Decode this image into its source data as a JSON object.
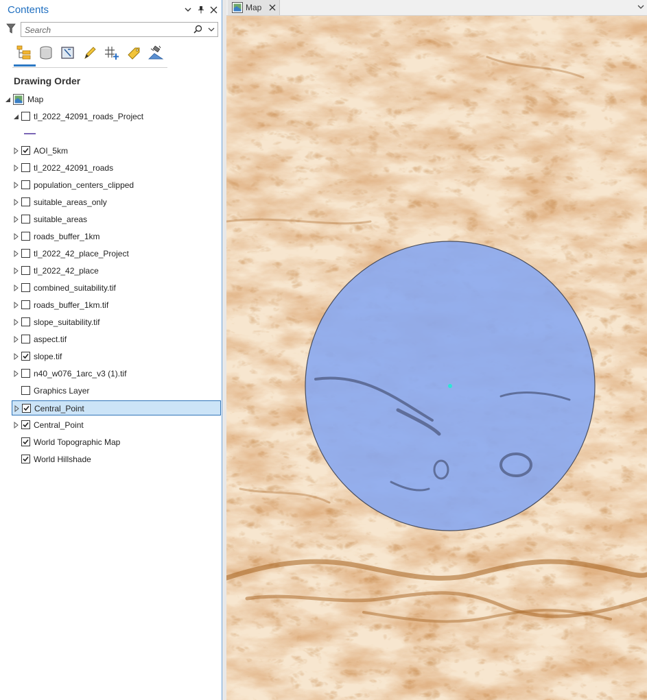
{
  "contents": {
    "title": "Contents",
    "search_placeholder": "Search",
    "section_title": "Drawing Order",
    "map_label": "Map",
    "layers": [
      {
        "label": "tl_2022_42091_roads_Project",
        "checked": false,
        "expander": "expanded"
      },
      {
        "label": "AOI_5km",
        "checked": true,
        "expander": "collapsed"
      },
      {
        "label": "tl_2022_42091_roads",
        "checked": false,
        "expander": "collapsed"
      },
      {
        "label": "population_centers_clipped",
        "checked": false,
        "expander": "collapsed"
      },
      {
        "label": "suitable_areas_only",
        "checked": false,
        "expander": "collapsed"
      },
      {
        "label": "suitable_areas",
        "checked": false,
        "expander": "collapsed"
      },
      {
        "label": "roads_buffer_1km",
        "checked": false,
        "expander": "collapsed"
      },
      {
        "label": "tl_2022_42_place_Project",
        "checked": false,
        "expander": "collapsed"
      },
      {
        "label": "tl_2022_42_place",
        "checked": false,
        "expander": "collapsed"
      },
      {
        "label": "combined_suitability.tif",
        "checked": false,
        "expander": "collapsed"
      },
      {
        "label": "roads_buffer_1km.tif",
        "checked": false,
        "expander": "collapsed"
      },
      {
        "label": "slope_suitability.tif",
        "checked": false,
        "expander": "collapsed"
      },
      {
        "label": "aspect.tif",
        "checked": false,
        "expander": "collapsed"
      },
      {
        "label": "slope.tif",
        "checked": true,
        "expander": "collapsed"
      },
      {
        "label": "n40_w076_1arc_v3 (1).tif",
        "checked": false,
        "expander": "collapsed"
      },
      {
        "label": "Graphics Layer",
        "checked": false,
        "expander": "none"
      },
      {
        "label": "Central_Point",
        "checked": true,
        "expander": "collapsed",
        "selected": true
      },
      {
        "label": "Central_Point",
        "checked": true,
        "expander": "collapsed"
      },
      {
        "label": "World Topographic Map",
        "checked": true,
        "expander": "none"
      },
      {
        "label": "World Hillshade",
        "checked": true,
        "expander": "none"
      }
    ]
  },
  "map_view": {
    "tab_label": "Map"
  },
  "colors": {
    "accent": "#1f6fc0",
    "selection_fill": "#cce4f7",
    "selection_border": "#2e73b8",
    "terrain_light": "#f7e6cf",
    "terrain_dark": "#b8722c",
    "aoi_fill": "#8aa9f0",
    "aoi_outline": "#4a4e5e",
    "point": "#2ee6d6"
  }
}
